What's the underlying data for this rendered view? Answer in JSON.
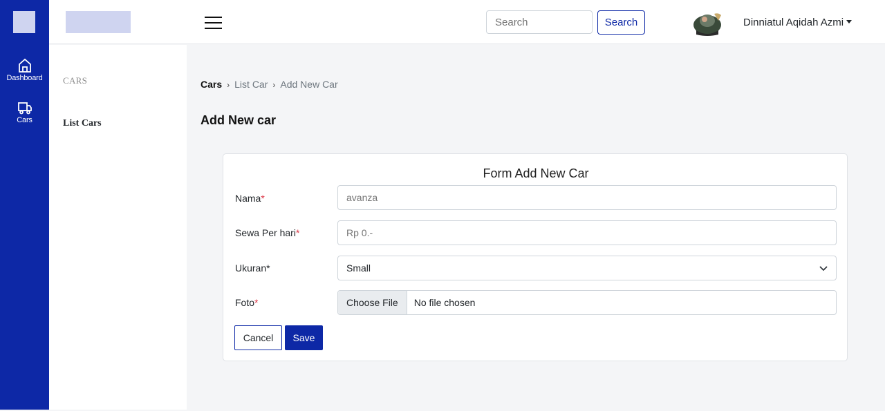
{
  "rail": {
    "items": [
      {
        "label": "Dashboard",
        "icon": "home-icon"
      },
      {
        "label": "Cars",
        "icon": "truck-icon"
      }
    ]
  },
  "header": {
    "search_placeholder": "Search",
    "search_button": "Search",
    "user_name": "Dinniatul Aqidah Azmi"
  },
  "subnav": {
    "heading": "CARS",
    "link": "List Cars"
  },
  "breadcrumb": {
    "root": "Cars",
    "sep": "›",
    "items": [
      "List Car",
      "Add New Car"
    ]
  },
  "page_title": "Add New car",
  "form": {
    "title": "Form Add New Car",
    "fields": {
      "nama": {
        "label": "Nama",
        "required_mark": "*",
        "placeholder": "avanza"
      },
      "sewa": {
        "label": "Sewa Per hari",
        "required_mark": "*",
        "placeholder": "Rp 0.-"
      },
      "ukuran": {
        "label": "Ukuran*",
        "value": "Small"
      },
      "foto": {
        "label": "Foto",
        "required_mark": "*",
        "button": "Choose File",
        "status": "No file chosen"
      }
    },
    "cancel": "Cancel",
    "save": "Save"
  },
  "colors": {
    "primary": "#0d28a6",
    "required": "#dc3545"
  }
}
